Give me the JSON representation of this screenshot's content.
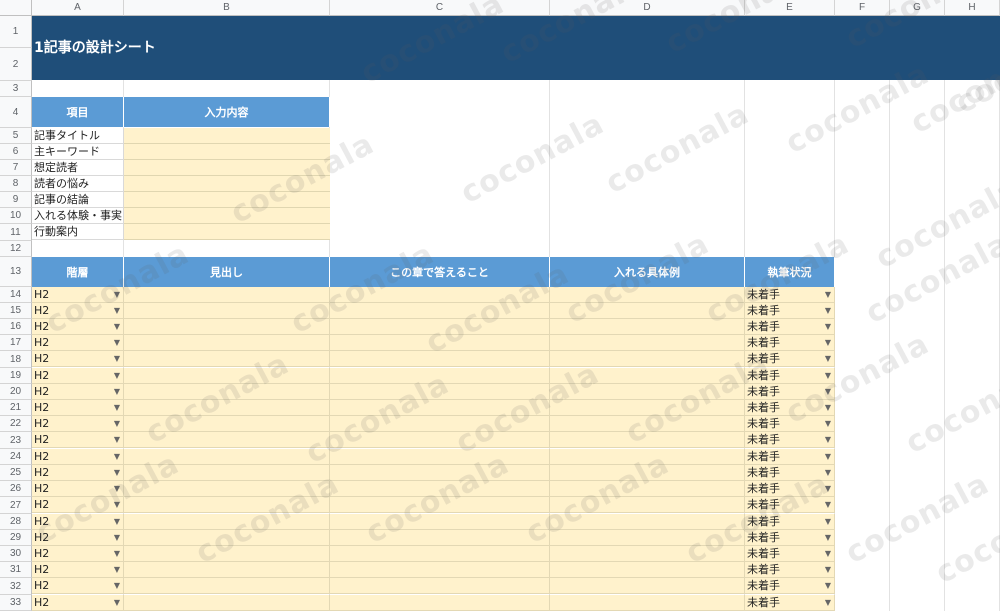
{
  "columns": [
    "A",
    "B",
    "C",
    "D",
    "E",
    "F",
    "G",
    "H"
  ],
  "rows": [
    "1",
    "2",
    "3",
    "4",
    "5",
    "6",
    "7",
    "8",
    "9",
    "10",
    "11",
    "12",
    "13",
    "14",
    "15",
    "16",
    "17",
    "18",
    "19",
    "20",
    "21",
    "22",
    "23",
    "24",
    "25",
    "26",
    "27",
    "28",
    "29",
    "30",
    "31",
    "32",
    "33"
  ],
  "title": "1記事の設計シート",
  "design_table": {
    "headers": [
      "項目",
      "入力内容"
    ],
    "items": [
      "記事タイトル",
      "主キーワード",
      "想定読者",
      "読者の悩み",
      "記事の結論",
      "入れる体験・事実",
      "行動案内"
    ]
  },
  "outline_table": {
    "headers": [
      "階層",
      "見出し",
      "この章で答えること",
      "入れる具体例",
      "執筆状況"
    ],
    "level_value": "H2",
    "status_value": "未着手",
    "row_count": 20
  },
  "watermark": "coconala",
  "colors": {
    "title_bg": "#1f4e79",
    "header_bg": "#5b9bd5",
    "input_bg": "#fff2cc"
  }
}
